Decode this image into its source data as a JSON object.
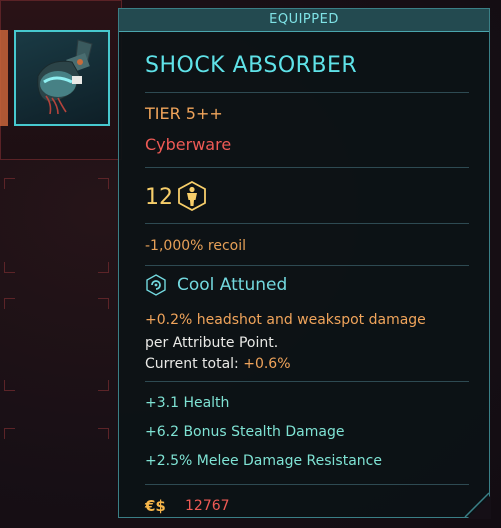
{
  "tooltip": {
    "header": "EQUIPPED",
    "title": "SHOCK ABSORBER",
    "tier": "TIER 5++",
    "type": "Cyberware",
    "requirement": "12",
    "requirement_icon": "body-attribute-icon",
    "recoil": "-1,000% recoil",
    "attunement": {
      "icon": "cool-attribute-icon",
      "label": "Cool Attuned",
      "line1": "+0.2% headshot and weakspot damage",
      "line2": "per Attribute Point.",
      "current_label": "Current total: ",
      "current_value": "+0.6%"
    },
    "bonuses": [
      "+3.1 Health",
      "+6.2 Bonus Stealth Damage",
      "+2.5% Melee Damage Resistance"
    ],
    "currency_symbol": "€$",
    "price": "12767"
  },
  "colors": {
    "accent_cyan": "#5fe2e8",
    "tier_orange": "#f0a45b",
    "type_red": "#ee5a55",
    "requirement_yellow": "#f7ce6a"
  }
}
